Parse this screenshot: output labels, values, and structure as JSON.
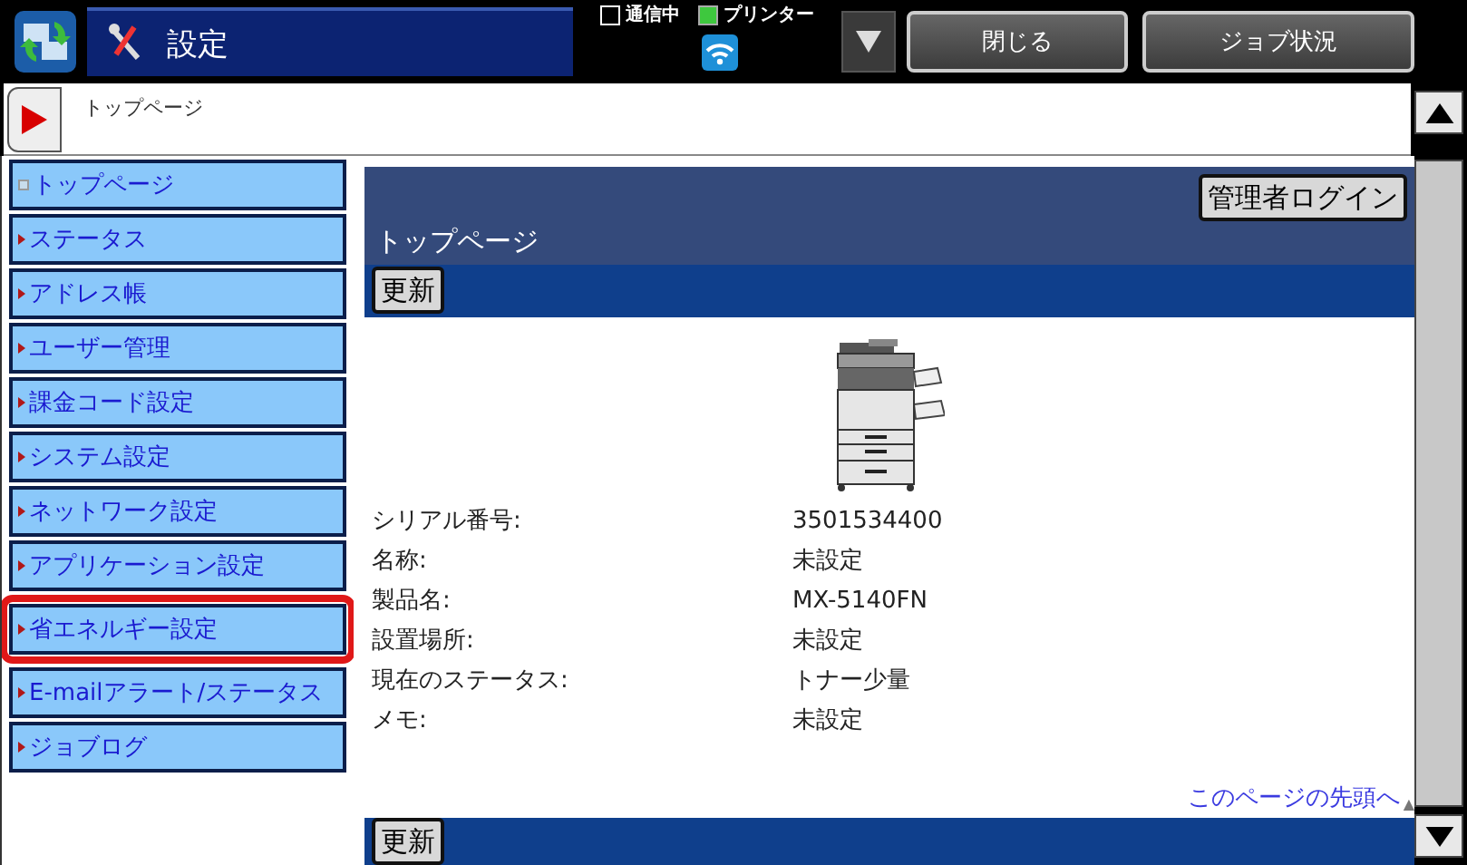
{
  "header": {
    "app_title": "設定",
    "indicators": [
      {
        "label": "通信中",
        "on": false
      },
      {
        "label": "プリンター",
        "on": true
      }
    ],
    "buttons": [
      "閉じる",
      "ジョブ状況"
    ]
  },
  "breadcrumb": "トップページ",
  "sidebar": {
    "items": [
      {
        "label": "トップページ",
        "selected": true,
        "highlighted": false
      },
      {
        "label": "ステータス",
        "selected": false,
        "highlighted": false
      },
      {
        "label": "アドレス帳",
        "selected": false,
        "highlighted": false
      },
      {
        "label": "ユーザー管理",
        "selected": false,
        "highlighted": false
      },
      {
        "label": "課金コード設定",
        "selected": false,
        "highlighted": false
      },
      {
        "label": "システム設定",
        "selected": false,
        "highlighted": false
      },
      {
        "label": "ネットワーク設定",
        "selected": false,
        "highlighted": false
      },
      {
        "label": "アプリケーション設定",
        "selected": false,
        "highlighted": false
      },
      {
        "label": "省エネルギー設定",
        "selected": false,
        "highlighted": true
      },
      {
        "label": "E-mailアラート/ステータス",
        "selected": false,
        "highlighted": false
      },
      {
        "label": "ジョブログ",
        "selected": false,
        "highlighted": false
      }
    ]
  },
  "content": {
    "admin_button": "管理者ログイン",
    "title": "トップページ",
    "refresh_buttons": [
      "更新",
      "更新"
    ],
    "info": [
      {
        "label": "シリアル番号:",
        "value": "3501534400"
      },
      {
        "label": "名称:",
        "value": "未設定"
      },
      {
        "label": "製品名:",
        "value": "MX-5140FN"
      },
      {
        "label": "設置場所:",
        "value": "未設定"
      },
      {
        "label": "現在のステータス:",
        "value": "トナー少量"
      },
      {
        "label": "メモ:",
        "value": "未設定"
      }
    ],
    "top_link": "このページの先頭へ",
    "top_link_glyph": "▲"
  }
}
